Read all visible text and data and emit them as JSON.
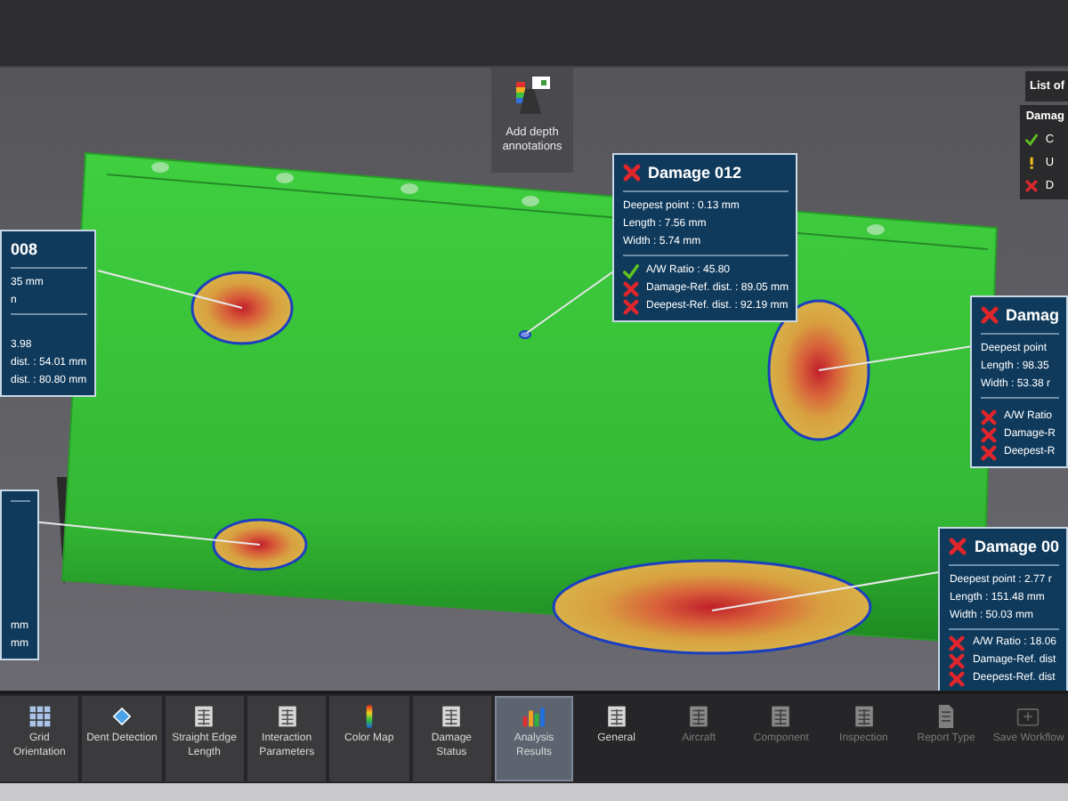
{
  "depth_button": {
    "label": "Add depth annotations"
  },
  "list_panel": {
    "title": "List of"
  },
  "legend_panel": {
    "title": "Damag",
    "items": [
      {
        "kind": "ok",
        "label": "C"
      },
      {
        "kind": "warn",
        "label": "U"
      },
      {
        "kind": "fail",
        "label": "D"
      }
    ]
  },
  "callouts": [
    {
      "title": "008",
      "measures": [
        "35 mm",
        "n"
      ],
      "checks": [
        {
          "text": "3.98"
        },
        {
          "text": "dist. : 54.01 mm"
        },
        {
          "text": "dist. : 80.80 mm"
        }
      ]
    },
    {
      "checks": [
        {
          "text": "mm"
        },
        {
          "text": "mm"
        }
      ]
    },
    {
      "title": "Damage 012",
      "kind": "fail",
      "measures": [
        "Deepest point : 0.13 mm",
        "Length : 7.56 mm",
        "Width : 5.74 mm"
      ],
      "checks": [
        {
          "kind": "ok",
          "text": "A/W Ratio : 45.80"
        },
        {
          "kind": "fail",
          "text": "Damage-Ref. dist. : 89.05 mm"
        },
        {
          "kind": "fail",
          "text": "Deepest-Ref. dist. : 92.19 mm"
        }
      ]
    },
    {
      "title": "Damag",
      "kind": "fail",
      "measures": [
        "Deepest point",
        "Length : 98.35",
        "Width : 53.38 r"
      ],
      "checks": [
        {
          "kind": "fail",
          "text": "A/W Ratio"
        },
        {
          "kind": "fail",
          "text": "Damage-R"
        },
        {
          "kind": "fail",
          "text": "Deepest-R"
        }
      ]
    },
    {
      "title": "Damage 00",
      "kind": "fail",
      "measures": [
        "Deepest point : 2.77 r",
        "Length : 151.48 mm",
        "Width : 50.03 mm"
      ],
      "checks": [
        {
          "kind": "fail",
          "text": "A/W Ratio : 18.06"
        },
        {
          "kind": "fail",
          "text": "Damage-Ref. dist"
        },
        {
          "kind": "fail",
          "text": "Deepest-Ref. dist"
        }
      ]
    }
  ],
  "toolbar": [
    {
      "kind": "grid",
      "label": "Grid Orientation",
      "selected": false,
      "disabled": false
    },
    {
      "kind": "dent",
      "label": "Dent Detection",
      "selected": false,
      "disabled": false
    },
    {
      "kind": "table",
      "label": "Straight Edge Length",
      "selected": false,
      "disabled": false
    },
    {
      "kind": "table",
      "label": "Interaction Parameters",
      "selected": false,
      "disabled": false
    },
    {
      "kind": "colorbar",
      "label": "Color Map",
      "selected": false,
      "disabled": false
    },
    {
      "kind": "table",
      "label": "Damage Status",
      "selected": false,
      "disabled": false
    },
    {
      "kind": "results",
      "label": "Analysis Results",
      "selected": true,
      "disabled": false
    },
    {
      "kind": "table",
      "label": "General",
      "selected": false,
      "disabled": false
    },
    {
      "kind": "table",
      "label": "Aircraft",
      "selected": false,
      "disabled": true
    },
    {
      "kind": "table",
      "label": "Component",
      "selected": false,
      "disabled": true
    },
    {
      "kind": "table",
      "label": "Inspection",
      "selected": false,
      "disabled": true
    },
    {
      "kind": "report",
      "label": "Report Type",
      "selected": false,
      "disabled": true
    },
    {
      "kind": "save",
      "label": "Save Workflow",
      "selected": false,
      "disabled": true
    }
  ]
}
